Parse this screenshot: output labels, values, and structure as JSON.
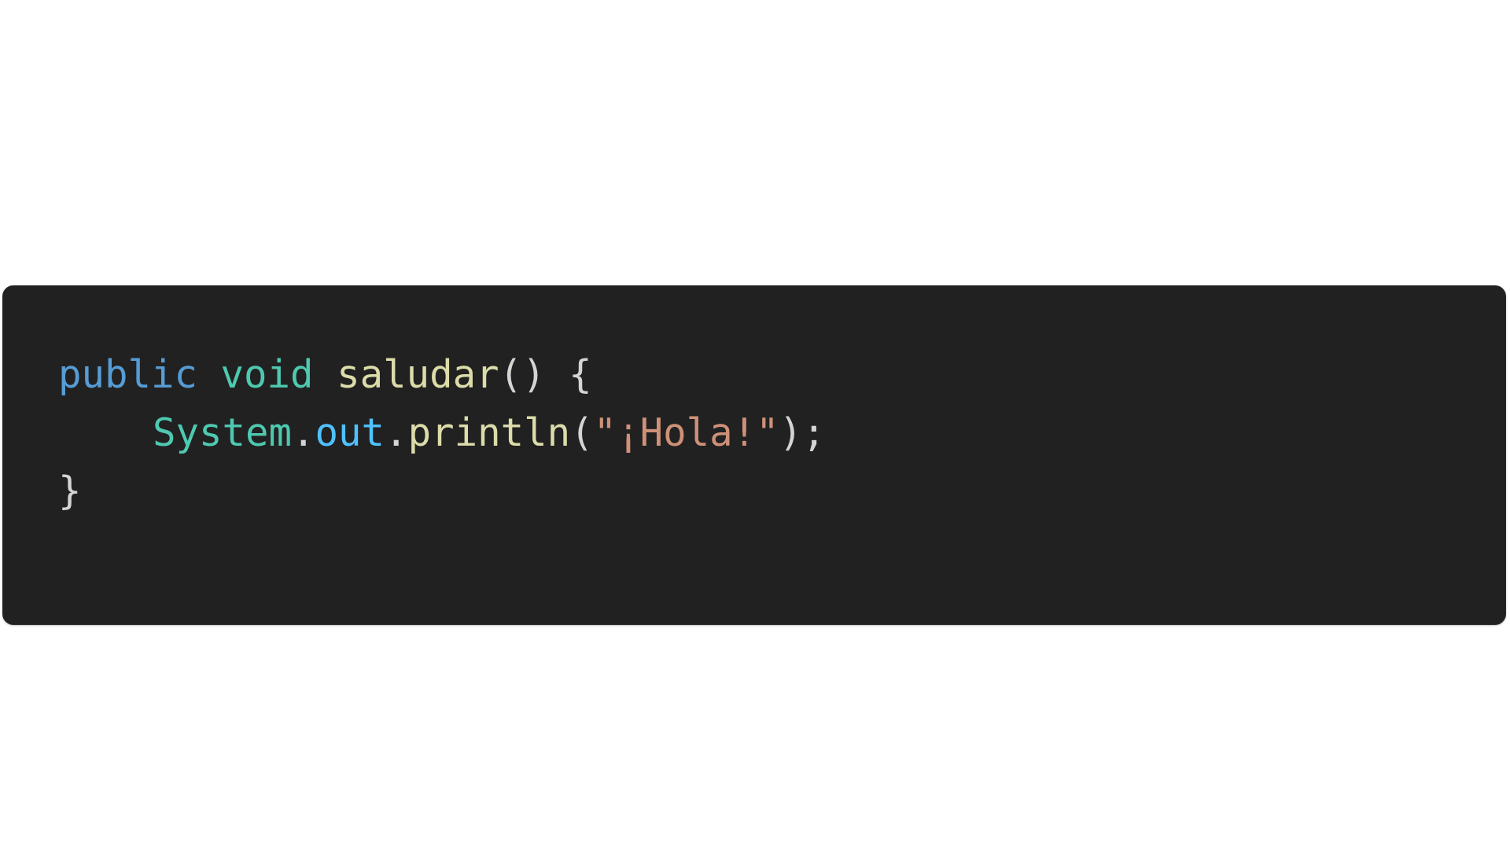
{
  "code": {
    "language": "java",
    "lines": [
      {
        "tokens": [
          {
            "text": "public",
            "kind": "keyword"
          },
          {
            "text": " ",
            "kind": "punct"
          },
          {
            "text": "void",
            "kind": "type"
          },
          {
            "text": " ",
            "kind": "punct"
          },
          {
            "text": "saludar",
            "kind": "func"
          },
          {
            "text": "() {",
            "kind": "punct"
          }
        ]
      },
      {
        "indent": true,
        "tokens": [
          {
            "text": "System",
            "kind": "type"
          },
          {
            "text": ".",
            "kind": "punct"
          },
          {
            "text": "out",
            "kind": "field"
          },
          {
            "text": ".",
            "kind": "punct"
          },
          {
            "text": "println",
            "kind": "func"
          },
          {
            "text": "(",
            "kind": "punct"
          },
          {
            "text": "\"¡Hola!\"",
            "kind": "string"
          },
          {
            "text": ");",
            "kind": "punct"
          }
        ]
      },
      {
        "tokens": [
          {
            "text": "}",
            "kind": "punct"
          }
        ]
      }
    ]
  },
  "colors": {
    "page_background": "#ffffff",
    "code_background": "#212121",
    "keyword": "#569cd6",
    "type": "#4ec9b0",
    "function": "#dcdcaa",
    "field": "#4fc1ff",
    "string": "#ce9178",
    "punctuation": "#d4d4d4"
  }
}
